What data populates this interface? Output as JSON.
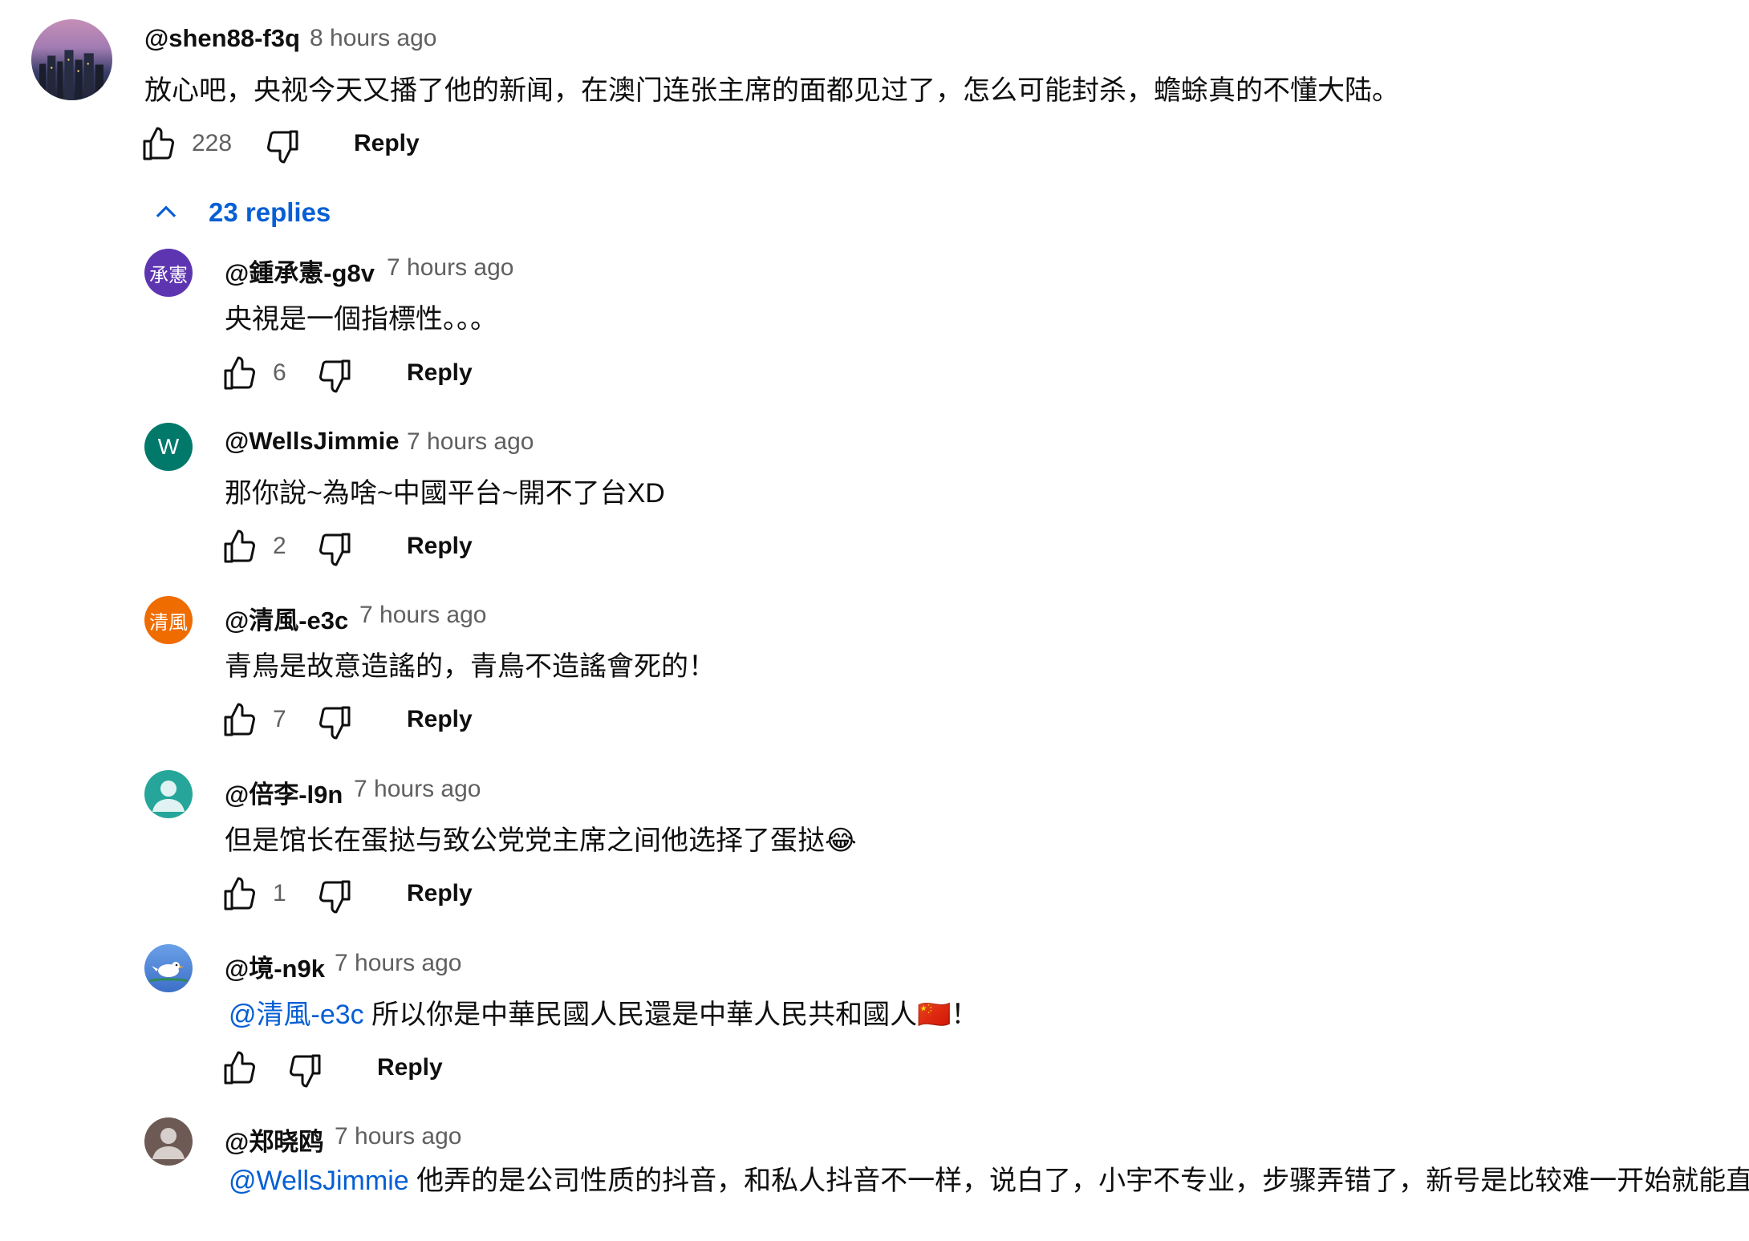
{
  "top_comment": {
    "author": "@shen88-f3q",
    "time": "8 hours ago",
    "text": "放心吧，央视今天又播了他的新闻，在澳门连张主席的面都见过了，怎么可能封杀，蟾蜍真的不懂大陆。",
    "likes": "228",
    "reply_label": "Reply",
    "avatar_icon": "city-night-avatar"
  },
  "replies_toggle": {
    "label": "23 replies",
    "icon": "chevron-up-icon"
  },
  "replies": [
    {
      "author": "@鍾承憲-g8v",
      "time": "7 hours ago",
      "mention": "",
      "text": "央視是一個指標性。。。",
      "likes": "6",
      "reply_label": "Reply",
      "avatar_text": "承憲",
      "avatar_color": "#5e35b1"
    },
    {
      "author": "@WellsJimmie",
      "time": "7 hours ago",
      "mention": "",
      "text": "那你說~為啥~中國平台~開不了台XD",
      "likes": "2",
      "reply_label": "Reply",
      "avatar_text": "W",
      "avatar_color": "#00796b"
    },
    {
      "author": "@清風-e3c",
      "time": "7 hours ago",
      "mention": "",
      "text": "青鳥是故意造謠的，青鳥不造謠會死的！",
      "likes": "7",
      "reply_label": "Reply",
      "avatar_text": "清風",
      "avatar_color": "#ef6c00"
    },
    {
      "author": "@倍李-l9n",
      "time": "7 hours ago",
      "mention": "",
      "text": "但是馆长在蛋挞与致公党党主席之间他选择了蛋挞😂",
      "likes": "1",
      "reply_label": "Reply",
      "avatar_text": "",
      "avatar_color": "#26a69a"
    },
    {
      "author": "@境-n9k",
      "time": "7 hours ago",
      "mention": "@清風-e3c",
      "text": " 所以你是中華民國人民還是中華人民共和國人🇨🇳！",
      "likes": "",
      "reply_label": "Reply",
      "avatar_text": "",
      "avatar_color": "#4a7fd6"
    },
    {
      "author": "@郑晓鸥",
      "time": "7 hours ago",
      "mention": "@WellsJimmie",
      "text": " 他弄的是公司性质的抖音，和私人抖音不一样，说白了，小宇不专业，步骤弄错了，新号是比较难一开始就能直播的",
      "likes": "",
      "reply_label": "Reply",
      "avatar_text": "",
      "avatar_color": "#6d5a55"
    }
  ],
  "colors": {
    "link": "#065fd4",
    "meta": "#606060",
    "text": "#0f0f0f"
  }
}
